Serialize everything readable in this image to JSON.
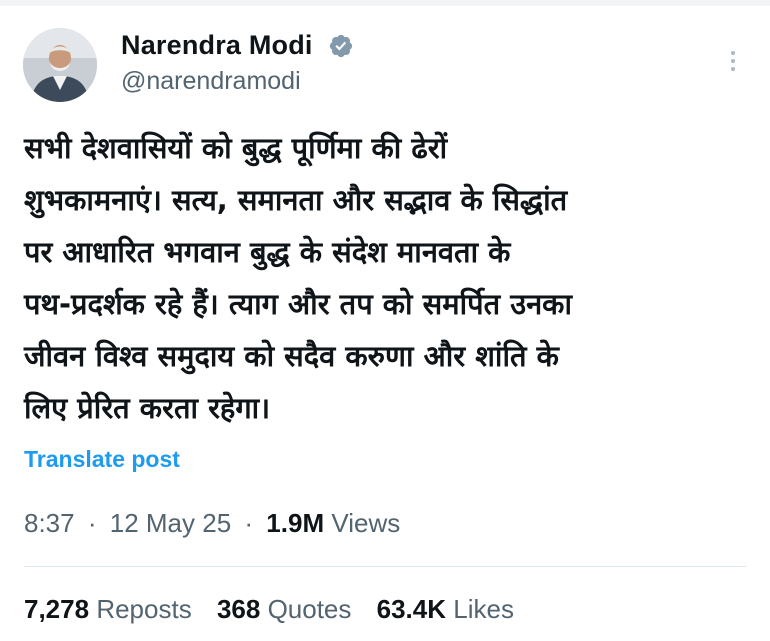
{
  "author": {
    "name": "Narendra Modi",
    "handle": "@narendramodi",
    "avatar_icon": "profile-photo",
    "verified_icon": "verified-badge",
    "verified_color": "#829aab"
  },
  "post": {
    "text": "सभी देशवासियों को बुद्ध पूर्णिमा की ढेरों\nशुभकामनाएं। सत्य, समानता और सद्भाव के सिद्धांत\nपर आधारित भगवान बुद्ध के संदेश मानवता के\nपथ-प्रदर्शक रहे हैं। त्याग और तप को समर्पित उनका\nजीवन विश्व समुदाय को सदैव करुणा और शांति के\nलिए प्रेरित करता रहेगा।",
    "translate_label": "Translate post",
    "time": "8:37",
    "date": "12 May 25",
    "views_count": "1.9M",
    "views_label": "Views",
    "separator": "·"
  },
  "stats": {
    "reposts_count": "7,278",
    "reposts_label": "Reposts",
    "quotes_count": "368",
    "quotes_label": "Quotes",
    "likes_count": "63.4K",
    "likes_label": "Likes"
  },
  "colors": {
    "link": "#1d9bf0",
    "text": "#0f1419",
    "muted": "#536471"
  },
  "more_icon": "more-vertical-icon"
}
